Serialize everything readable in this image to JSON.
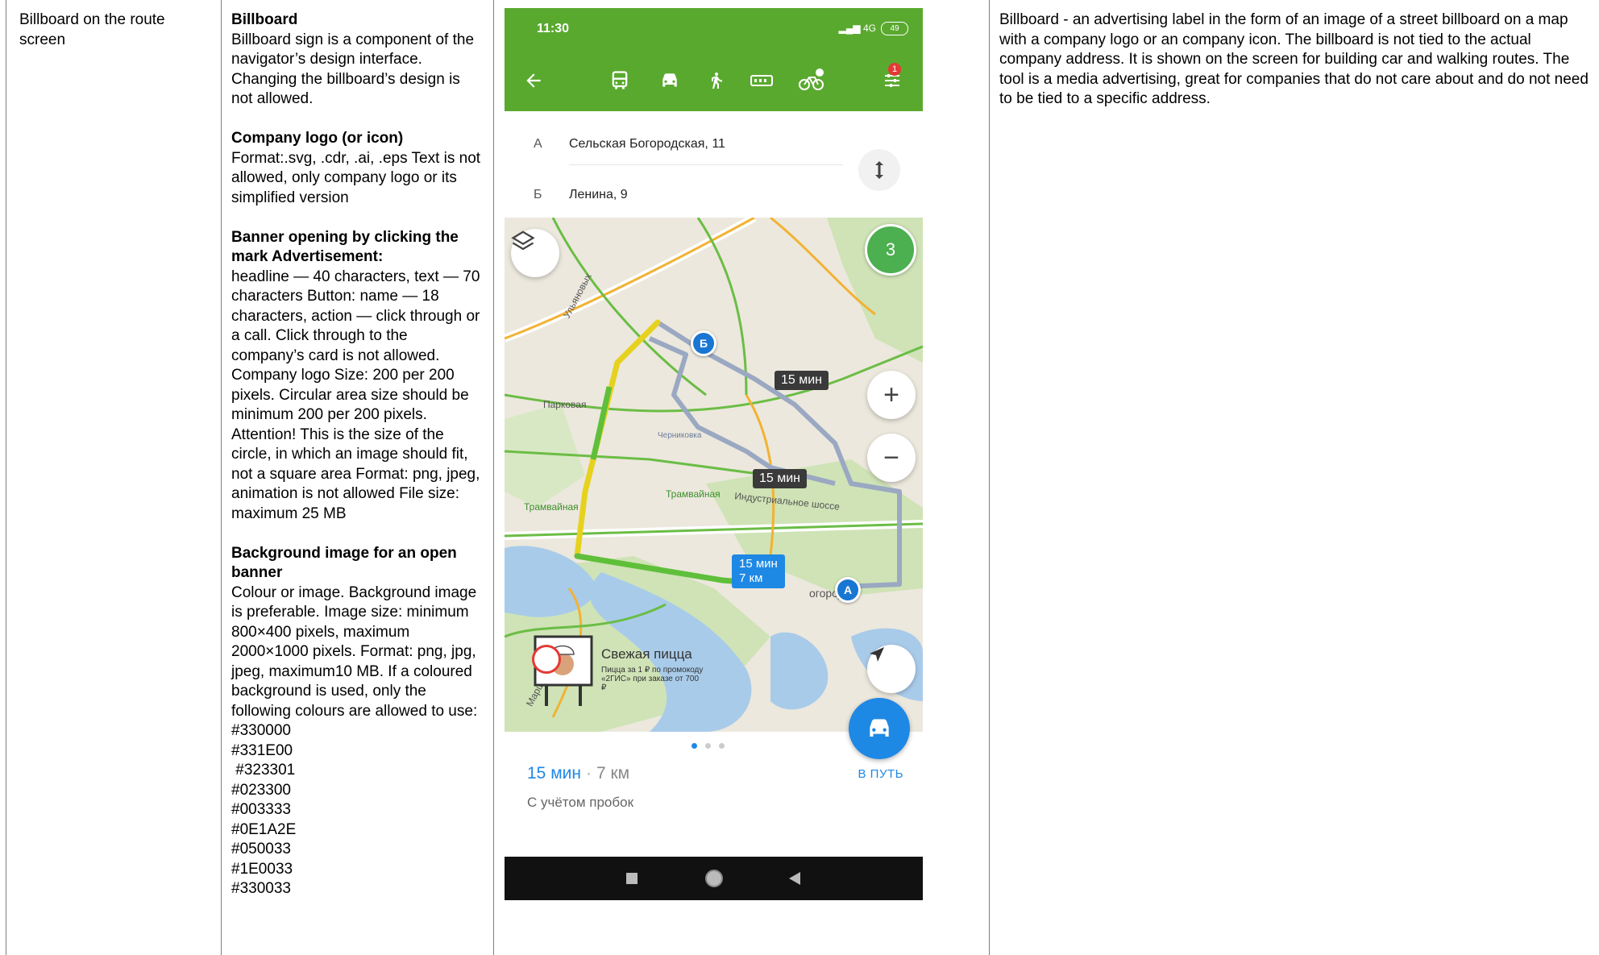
{
  "row_label": "Billboard on the route screen",
  "requirements": {
    "billboard": {
      "heading": "Billboard",
      "text": "Billboard sign is a component of the navigator’s design interface. Changing the billboard’s design is not allowed."
    },
    "logo": {
      "heading": "Company logo (or icon)",
      "text": "Format:.svg, .cdr, .ai, .eps Text is not allowed, only company logo or its simplified version"
    },
    "banner": {
      "heading": "Banner opening by clicking the mark Advertisement:",
      "text": "headline — 40 characters, text — 70 characters Button: name — 18 characters, action — click through or a call. Click through to the company’s card is not allowed. Company logo Size: 200 per 200 pixels. Circular area size should be minimum 200 per 200 pixels. Attention! This is the size of the circle, in which an image should fit, not a square area Format: png, jpeg, animation is not allowed File size: maximum 25 MB"
    },
    "background": {
      "heading": "Background image for an open banner",
      "text": "Colour or image. Background image is preferable. Image size: minimum 800×400 pixels, maximum 2000×1000 pixels. Format: png, jpg, jpeg, maximum10 MB. If a coloured background is used, only the following colours are allowed to use:",
      "colors": [
        "#330000",
        "#331E00",
        " #323301",
        "#023300",
        "#003333",
        "#0E1A2E",
        "#050033",
        "#1E0033",
        "#330033"
      ]
    }
  },
  "description": "Billboard - an advertising label in the form of an image of a street billboard on a map with a company logo or an company icon. The billboard is not tied to the actual company address. It is shown on the screen for building car and walking routes. The tool is a media advertising, great for companies that do not care about and do not need to be tied to a specific address.",
  "phone": {
    "status_time": "11:30",
    "status_network": "4G",
    "battery": "49",
    "filter_badge": "1",
    "point_a_tag": "А",
    "point_a": "Сельская Богородская, 11",
    "point_b_tag": "Б",
    "point_b": "Ленина, 9",
    "cluster_count": "3",
    "route_time_1": "15 мин",
    "route_time_2": "15 мин",
    "route_main_time": "15 мин",
    "route_main_dist": "7 км",
    "map_labels": {
      "ulyanovykh": "Ульяновых",
      "parkovaya": "Парковая",
      "chernikovka": "Черниковка",
      "tramvaynaya_1": "Трамвайная",
      "tramvaynaya_2": "Трамвайная",
      "industrialnoe": "Индустриальное шоссе",
      "bogorods": "огородс",
      "zhukova": "Маршала Жукова"
    },
    "billboard_title": "Свежая пицца",
    "billboard_text": "Пицца за 1 ₽ по промокоду «2ГИС» при заказе от 700 ₽",
    "pin_a": "А",
    "pin_b": "Б",
    "trip_time": "15 мин",
    "trip_sep": "·",
    "trip_dist": "7 км",
    "traffic_note": "С учётом пробок",
    "go_label": "В ПУТЬ"
  }
}
